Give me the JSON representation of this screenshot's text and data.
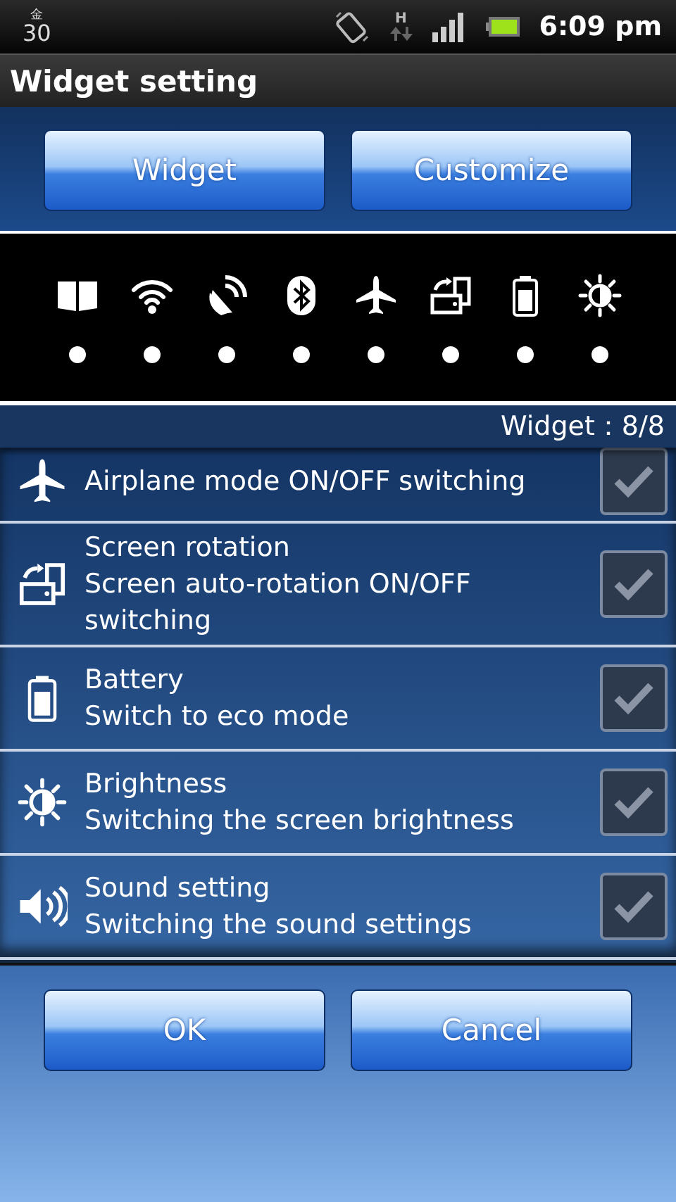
{
  "status_bar": {
    "date_day": "金",
    "date_number": "30",
    "network": "H",
    "time": "6:09 pm"
  },
  "window": {
    "title": "Widget setting"
  },
  "top_buttons": [
    {
      "label": "Widget"
    },
    {
      "label": "Customize"
    }
  ],
  "widgets": [
    {
      "kind": "book"
    },
    {
      "kind": "wifi"
    },
    {
      "kind": "gps"
    },
    {
      "kind": "bluetooth"
    },
    {
      "kind": "airplane"
    },
    {
      "kind": "rotation"
    },
    {
      "kind": "battery"
    },
    {
      "kind": "brightness"
    }
  ],
  "counter": "Widget：8/8",
  "settings": [
    {
      "kind": "airplane",
      "description": "Airplane mode ON/OFF switching",
      "checked": true
    },
    {
      "kind": "rotation",
      "title": "Screen rotation",
      "description": "Screen auto-rotation ON/OFF switching",
      "checked": true
    },
    {
      "kind": "battery",
      "title": "Battery",
      "description": "Switch to eco mode",
      "checked": true
    },
    {
      "kind": "brightness",
      "title": "Brightness",
      "description": "Switching the screen brightness",
      "checked": true
    },
    {
      "kind": "sound",
      "title": "Sound setting",
      "description": "Switching the sound settings",
      "checked": true
    }
  ],
  "buttons": [
    {
      "label": "OK"
    },
    {
      "label": "Cancel"
    }
  ]
}
